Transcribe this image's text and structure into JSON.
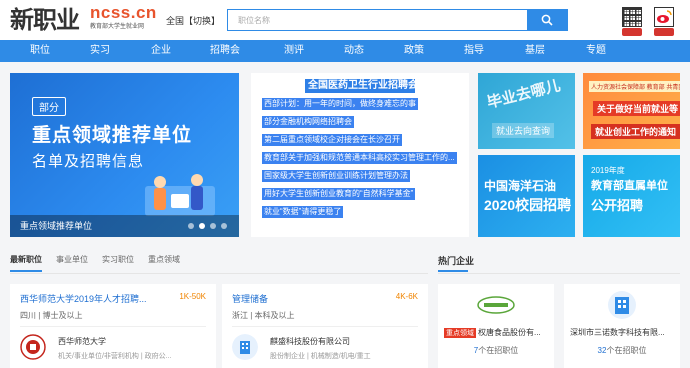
{
  "header": {
    "logo_cn": "新职业",
    "logo_en": "ncss.cn",
    "logo_sub": "教育部大学生就业网",
    "region_label": "全国【切换】",
    "search_placeholder": "职位名称"
  },
  "nav": {
    "items": [
      "职位",
      "实习",
      "企业",
      "招聘会",
      "测评",
      "动态",
      "政策",
      "指导",
      "基层",
      "专题"
    ],
    "active_index": 0
  },
  "slider": {
    "tag": "部分",
    "title": "重点领域推荐单位",
    "subtitle": "名单及招聘信息",
    "caption": "重点领域推荐单位",
    "dot_count": 4,
    "active_dot": 1
  },
  "news": {
    "title": "全国医药卫生行业招聘会",
    "items": [
      "西部计划：用一年的时间，做终身难忘的事",
      "部分金融机构网络招聘会",
      "第二届重点领域校企对接会在长沙召开",
      "教育部关于加强和规范普通本科高校实习管理工作的...",
      "国家级大学生创新创业训练计划管理办法",
      "用好大学生创新创业教育的“自然科学基金”",
      "就业“数据”请得更稳了"
    ]
  },
  "tiles": {
    "t1_main": "毕业去哪儿",
    "t1_sub": "就业去向查询",
    "t2_top": "人力资源社会保障部 教育部 共青团中央 全国工商联",
    "t2_main": "关于做好当前就业等",
    "t2_sub": "就业创业工作的通知",
    "t3_main": "中国海洋石油",
    "t3_sub": "2020校园招聘",
    "t4_year": "2019年度",
    "t4_main": "教育部直属单位",
    "t4_sub": "公开招聘"
  },
  "tabs": {
    "items": [
      "最新职位",
      "事业单位",
      "实习职位",
      "重点领域"
    ],
    "active_index": 0,
    "hot_title": "热门企业"
  },
  "jobs": [
    {
      "title": "西华师范大学2019年人才招聘...",
      "salary": "1K-50K",
      "meta": "四川 | 博士及以上",
      "company": "西华师范大学",
      "category": "机关/事业单位/非营利机构 | 政府公..."
    },
    {
      "title": "管理储备",
      "salary": "4K-6K",
      "meta": "浙江 | 本科及以上",
      "company": "麒盛科技股份有限公司",
      "category": "股份制企业 | 机械制造/机电/重工"
    }
  ],
  "companies": [
    {
      "badge": "重点领域",
      "name": "权唐食品股份有...",
      "count": "7",
      "count_suffix": "个在招职位"
    },
    {
      "badge": "",
      "name": "深圳市三诺数字科技有限...",
      "count": "32",
      "count_suffix": "个在招职位"
    }
  ],
  "colors": {
    "primary": "#2f8be6",
    "salary": "#f08400",
    "logo_accent": "#e8542d",
    "badge_red": "#e53b26"
  }
}
